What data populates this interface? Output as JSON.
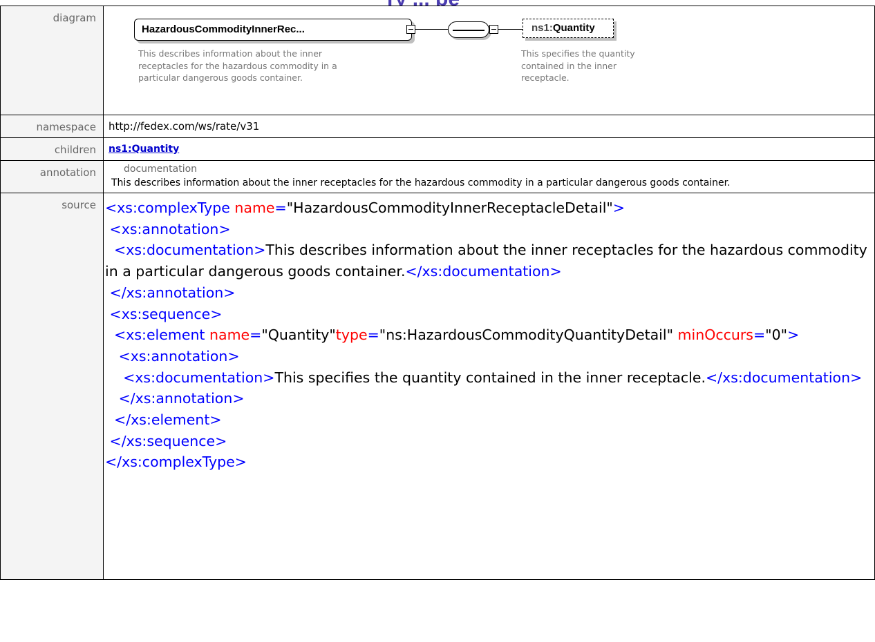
{
  "header": {
    "title_fragment": "ry ... pe"
  },
  "labels": {
    "diagram": "diagram",
    "namespace": "namespace",
    "children": "children",
    "annotation": "annotation",
    "source": "source"
  },
  "diagram": {
    "main_element": "HazardousCommodityInnerRec...",
    "main_description_lines": [
      "This describes information about the inner",
      "receptacles for the hazardous commodity in a",
      "particular dangerous goods container."
    ],
    "child_prefix": "ns1:",
    "child_name": "Quantity",
    "child_description_lines": [
      "This specifies the quantity",
      "contained in the inner",
      "receptacle."
    ]
  },
  "namespace": "http://fedex.com/ws/rate/v31",
  "children": [
    "ns1:Quantity"
  ],
  "annotation": {
    "heading": "documentation",
    "text": "This describes information about the inner receptacles for the hazardous commodity  in a particular dangerous goods container."
  },
  "source": {
    "ct_open": "<xs:complexType",
    "ct_name_attr": "name",
    "ct_name_val": "\"HazardousCommodityInnerReceptacleDetail\"",
    "gt": ">",
    "ann_open": "<xs:annotation",
    "doc_open": "<xs:documentation",
    "doc1_text": "This describes information about the inner receptacles for the hazardous commodity in a particular dangerous goods container.",
    "doc_close": "</xs:documentation",
    "ann_close": "</xs:annotation",
    "seq_open": "<xs:sequence",
    "el_open": "<xs:element",
    "el_name_attr": "name",
    "el_name_val": "\"Quantity\"",
    "el_type_attr": "type",
    "el_type_val": "\"ns:HazardousCommodityQuantityDetail\"",
    "el_min_attr": "minOccurs",
    "el_min_val": "\"0\"",
    "doc2_text": "This specifies the quantity contained in the inner receptacle.",
    "el_close": "</xs:element",
    "seq_close": "</xs:sequence",
    "ct_close": "</xs:complexType",
    "eq": "="
  }
}
